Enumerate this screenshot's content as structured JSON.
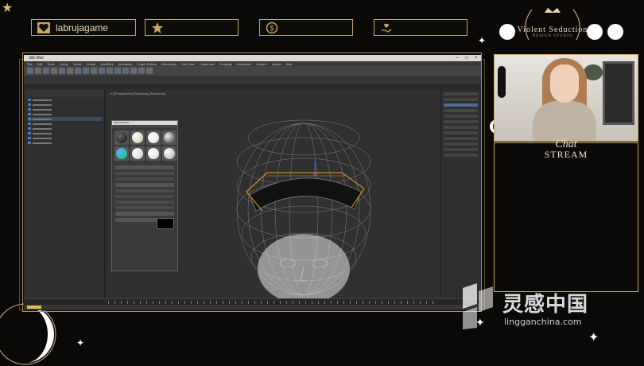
{
  "overlay": {
    "accent_color": "#c9a566",
    "top_boxes": [
      {
        "icon": "heart-icon",
        "label": "labrujagame"
      },
      {
        "icon": "star-icon",
        "label": ""
      },
      {
        "icon": "dollar-coin-icon",
        "label": ""
      },
      {
        "icon": "hand-heart-icon",
        "label": ""
      }
    ],
    "logo": {
      "name": "Violent Seduction",
      "sub": "DESIGN STUDIO"
    },
    "chat": {
      "script_title": "Chat",
      "title": "STREAM"
    }
  },
  "app": {
    "window_title": "3ds Max",
    "menu": [
      "File",
      "Edit",
      "Tools",
      "Group",
      "Views",
      "Create",
      "Modifiers",
      "Animation",
      "Graph Editors",
      "Rendering",
      "Civil View",
      "Customize",
      "Scripting",
      "Interactive",
      "Content",
      "Arnold",
      "Help"
    ],
    "viewport_label": "[+] [Perspective] [Standard] [Wireframe]",
    "material_editor_title": "Material Editor"
  },
  "watermark": {
    "text_cn": "灵感中国",
    "url": "lingganchina.com"
  }
}
